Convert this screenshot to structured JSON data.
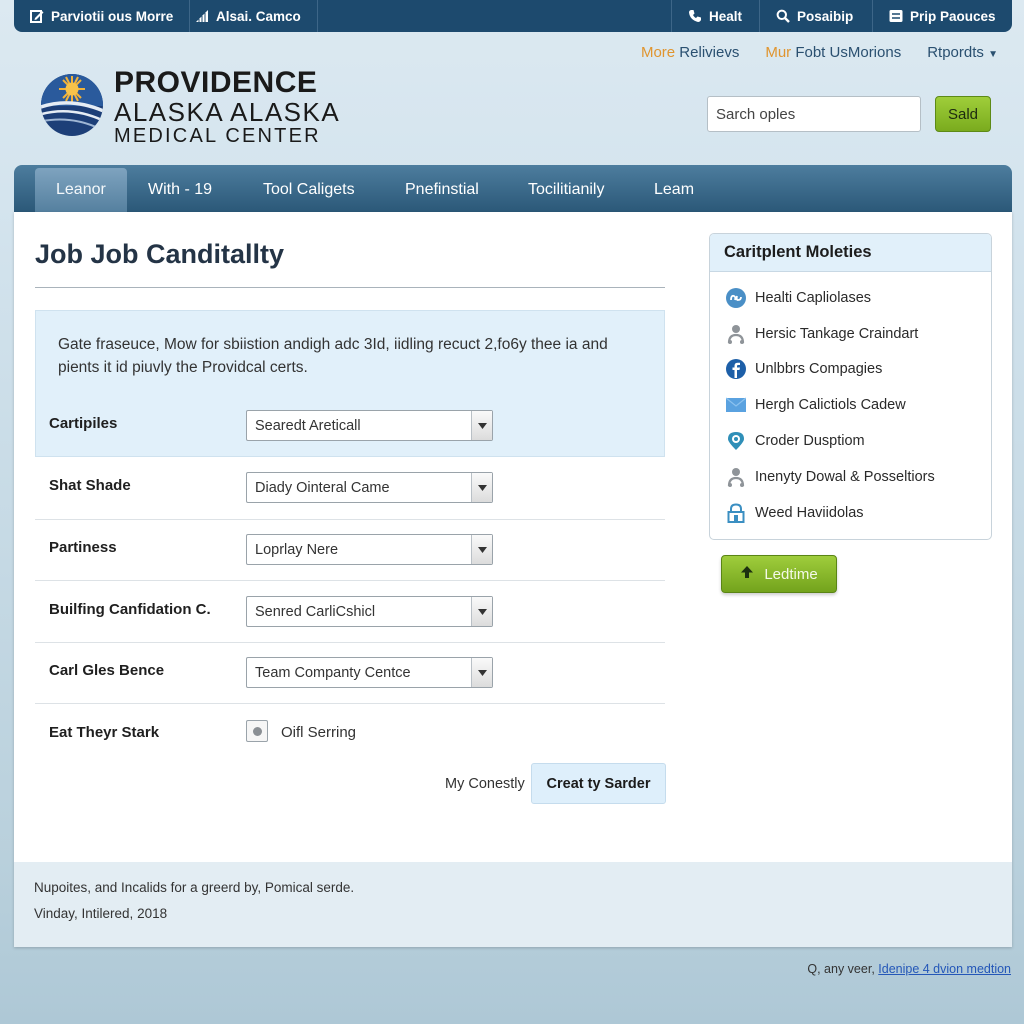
{
  "topbar": {
    "left": [
      {
        "label": "Parviotii ous Morre",
        "icon": "edit-icon"
      },
      {
        "label": "Alsai. Camco",
        "icon": "signal-icon"
      }
    ],
    "right": [
      {
        "label": "Healt",
        "icon": "phone-icon"
      },
      {
        "label": "Posaibip",
        "icon": "search-icon"
      },
      {
        "label": "Prip Paouces",
        "icon": "list-icon"
      }
    ]
  },
  "secondary_links": [
    {
      "highlight": "More",
      "rest": " Relivievs"
    },
    {
      "highlight": "Mur",
      "rest": " Fobt UsMorions"
    },
    {
      "highlight": "",
      "rest": "Rtpordts",
      "dropdown": true
    }
  ],
  "logo": {
    "line1": "PROVIDENCE",
    "line2": "ALASKA ALASKA",
    "line3": "MEDICAL CENTER",
    "colors": {
      "navy": "#1d3f78",
      "sun": "#f2b33a"
    }
  },
  "search": {
    "value": "Sarch oples",
    "button_label": "Sald"
  },
  "nav": {
    "items": [
      "Leanor",
      "With - 19",
      "Tool Caligets",
      "Pnefinstial",
      "Tocilitianily",
      "Leam"
    ],
    "active_index": 0
  },
  "main": {
    "title": "Job Job Canditallty",
    "intro": "Gate fraseuce, Mow for sbiistion andigh adc 3Id, iidling recuct 2,fo6y thee ia and pients it id piuvly the Providcal certs.",
    "form": [
      {
        "label": "Cartipiles",
        "value": "Searedt Areticall"
      },
      {
        "label": "Shat Shade",
        "value": "Diady Ointeral Came"
      },
      {
        "label": "Partiness",
        "value": "Loprlay Nere"
      },
      {
        "label": "Builfing Canfidation C.",
        "value": "Senred CarliCshicl"
      },
      {
        "label": "Carl Gles Bence",
        "value": "Team Companty Centce"
      }
    ],
    "checkbox_row": {
      "label": "Eat Theyr Stark",
      "option": "Oifl Serring",
      "checked": true
    },
    "secondary_action": "My Conestly",
    "primary_action": "Creat ty Sarder"
  },
  "sidebar": {
    "title": "Caritplent Moleties",
    "items": [
      {
        "label": "Healti Capliolases",
        "icon": "link-icon"
      },
      {
        "label": "Hersic Tankage Craindart",
        "icon": "user-icon"
      },
      {
        "label": "Unlbbrs Compagies",
        "icon": "facebook-icon"
      },
      {
        "label": "Hergh Calictiols Cadew",
        "icon": "mail-icon"
      },
      {
        "label": "Croder Dusptiom",
        "icon": "location-pin-icon"
      },
      {
        "label": "Inenyty Dowal & Posseltiors",
        "icon": "user-icon"
      },
      {
        "label": "Weed Haviidolas",
        "icon": "lock-icon"
      }
    ],
    "button_label": "Ledtime"
  },
  "footer": {
    "line1": "Nupoites, and Incalids for a greerd by, Pomical serde.",
    "line2": "Vinday, Intilered, 2018"
  },
  "bottom_note": {
    "text": "Q, any veer, ",
    "link": "Idenipe 4 dvion medtion"
  },
  "colors": {
    "brand_navy": "#1d4a6e",
    "nav_blue": "#2b5878",
    "accent_orange": "#e0952f",
    "accent_green": "#7aab1e",
    "info_blue": "#e1f0fa",
    "link_blue": "#2457b8"
  }
}
